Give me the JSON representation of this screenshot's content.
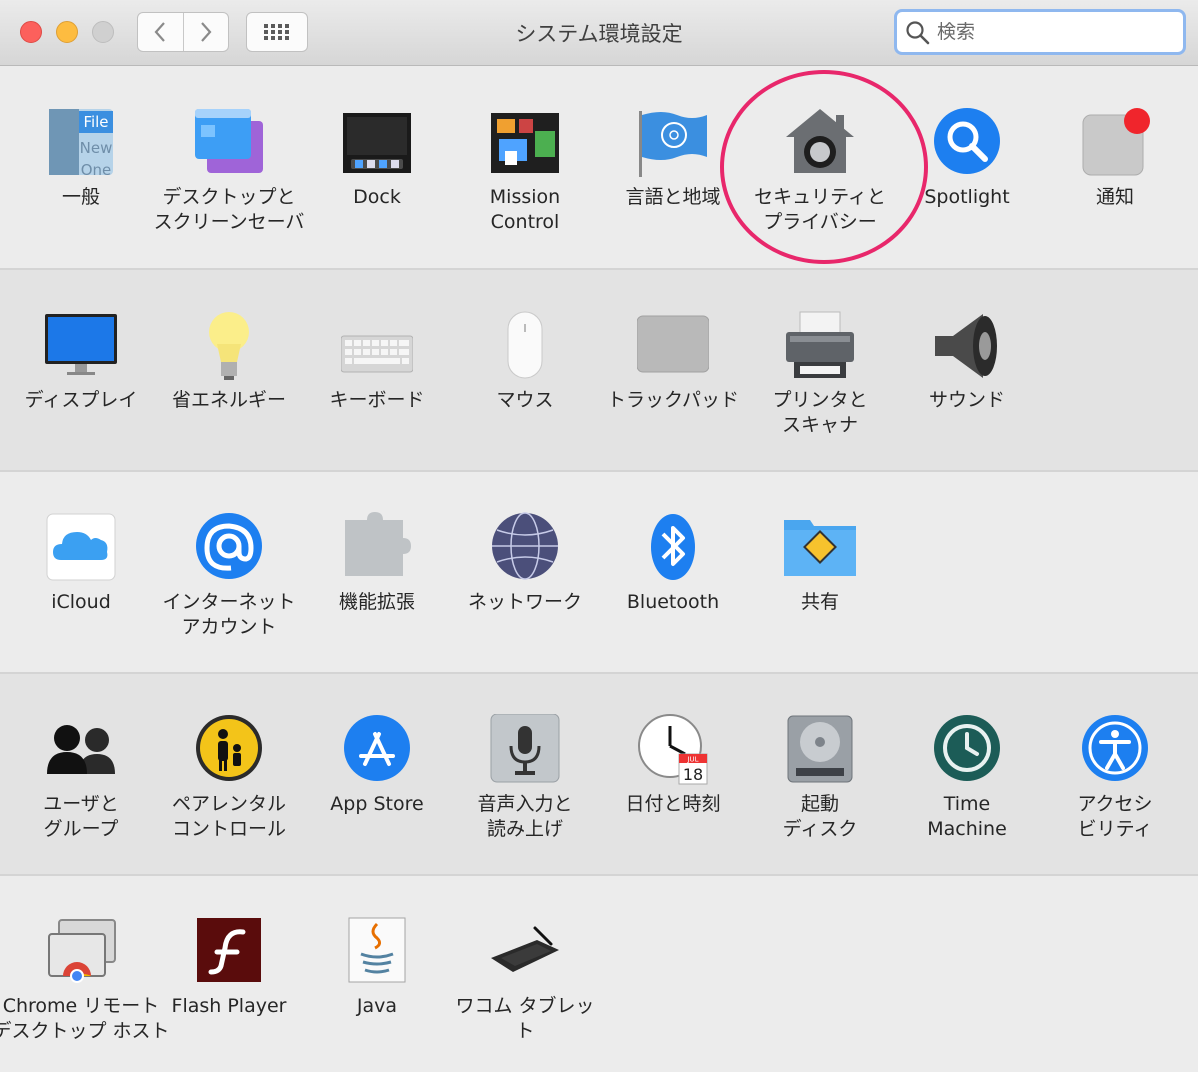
{
  "window": {
    "title": "システム環境設定"
  },
  "search": {
    "placeholder": "検索"
  },
  "rows": [
    [
      {
        "label": "一般",
        "icon": "general-icon"
      },
      {
        "label": "デスクトップと\nスクリーンセーバ",
        "icon": "desktop-screensaver-icon"
      },
      {
        "label": "Dock",
        "icon": "dock-icon"
      },
      {
        "label": "Mission\nControl",
        "icon": "mission-control-icon"
      },
      {
        "label": "言語と地域",
        "icon": "language-region-icon"
      },
      {
        "label": "セキュリティと\nプライバシー",
        "icon": "security-privacy-icon"
      },
      {
        "label": "Spotlight",
        "icon": "spotlight-icon"
      },
      {
        "label": "通知",
        "icon": "notifications-icon"
      }
    ],
    [
      {
        "label": "ディスプレイ",
        "icon": "display-icon"
      },
      {
        "label": "省エネルギー",
        "icon": "energy-saver-icon"
      },
      {
        "label": "キーボード",
        "icon": "keyboard-icon"
      },
      {
        "label": "マウス",
        "icon": "mouse-icon"
      },
      {
        "label": "トラックパッド",
        "icon": "trackpad-icon"
      },
      {
        "label": "プリンタと\nスキャナ",
        "icon": "printer-scanner-icon"
      },
      {
        "label": "サウンド",
        "icon": "sound-icon"
      }
    ],
    [
      {
        "label": "iCloud",
        "icon": "icloud-icon"
      },
      {
        "label": "インターネット\nアカウント",
        "icon": "internet-accounts-icon"
      },
      {
        "label": "機能拡張",
        "icon": "extensions-icon"
      },
      {
        "label": "ネットワーク",
        "icon": "network-icon"
      },
      {
        "label": "Bluetooth",
        "icon": "bluetooth-icon"
      },
      {
        "label": "共有",
        "icon": "sharing-icon"
      }
    ],
    [
      {
        "label": "ユーザと\nグループ",
        "icon": "users-groups-icon"
      },
      {
        "label": "ペアレンタル\nコントロール",
        "icon": "parental-controls-icon"
      },
      {
        "label": "App Store",
        "icon": "app-store-icon"
      },
      {
        "label": "音声入力と\n読み上げ",
        "icon": "dictation-speech-icon"
      },
      {
        "label": "日付と時刻",
        "icon": "date-time-icon"
      },
      {
        "label": "起動\nディスク",
        "icon": "startup-disk-icon"
      },
      {
        "label": "Time\nMachine",
        "icon": "time-machine-icon"
      },
      {
        "label": "アクセシ\nビリティ",
        "icon": "accessibility-icon"
      }
    ],
    [
      {
        "label": "Chrome リモート\nデスクトップ ホスト",
        "icon": "chrome-remote-desktop-icon"
      },
      {
        "label": "Flash Player",
        "icon": "flash-player-icon"
      },
      {
        "label": "Java",
        "icon": "java-icon"
      },
      {
        "label": "ワコム タブレット",
        "icon": "wacom-tablet-icon"
      }
    ]
  ],
  "icon_text": {
    "general_file": "File",
    "general_new": "New",
    "general_one": "One",
    "calendar_month": "JUL",
    "calendar_day": "18"
  }
}
